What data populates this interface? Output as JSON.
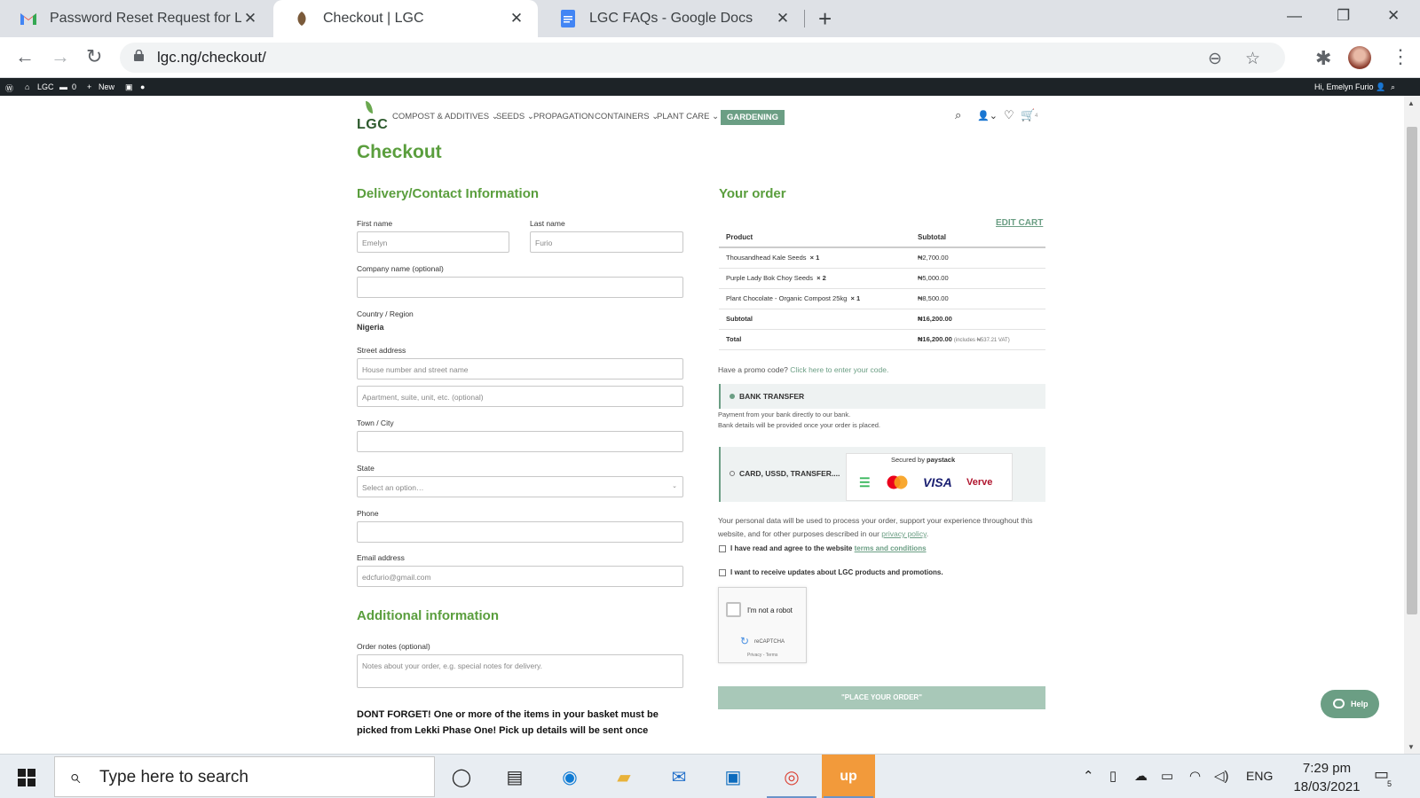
{
  "browser": {
    "tabs": [
      {
        "title": "Password Reset Request for LGC",
        "icon": "gmail-icon"
      },
      {
        "title": "Checkout | LGC",
        "icon": "leaf-icon"
      },
      {
        "title": "LGC FAQs - Google Docs",
        "icon": "google-docs-icon"
      }
    ],
    "url": "lgc.ng/checkout/"
  },
  "adminbar": {
    "site": "LGC",
    "comments": "0",
    "new": "New",
    "greeting": "Hi, Emelyn Furio"
  },
  "header": {
    "logo": "LGC",
    "menu": [
      "COMPOST & ADDITIVES",
      "SEEDS",
      "PROPAGATION",
      "CONTAINERS",
      "PLANT CARE"
    ],
    "gardening": "GARDENING",
    "cart_count": "4"
  },
  "checkout": {
    "title": "Checkout",
    "delivery_title": "Delivery/Contact Information",
    "first_name_label": "First name",
    "first_name_value": "Emelyn",
    "last_name_label": "Last name",
    "last_name_value": "Furio",
    "company_label": "Company name (optional)",
    "country_label": "Country / Region",
    "country_value": "Nigeria",
    "street_label": "Street address",
    "street_placeholder": "House number and street name",
    "street2_placeholder": "Apartment, suite, unit, etc. (optional)",
    "town_label": "Town / City",
    "state_label": "State",
    "state_placeholder": "Select an option…",
    "phone_label": "Phone",
    "email_label": "Email address",
    "email_value": "edcfurio@gmail.com",
    "additional_title": "Additional information",
    "notes_label": "Order notes (optional)",
    "notes_placeholder": "Notes about your order, e.g. special notes for delivery.",
    "dont_forget": "DONT FORGET! One or more of the items in your basket must be picked from Lekki Phase One! Pick up details will be sent once"
  },
  "order": {
    "title": "Your order",
    "edit_cart": "EDIT CART",
    "col_product": "Product",
    "col_subtotal": "Subtotal",
    "items": [
      {
        "name": "Thousandhead Kale Seeds",
        "qty": "× 1",
        "price": "₦2,700.00"
      },
      {
        "name": "Purple Lady Bok Choy Seeds",
        "qty": "× 2",
        "price": "₦5,000.00"
      },
      {
        "name": "Plant Chocolate - Organic Compost 25kg",
        "qty": "× 1",
        "price": "₦8,500.00"
      }
    ],
    "subtotal_label": "Subtotal",
    "subtotal_value": "₦16,200.00",
    "total_label": "Total",
    "total_value": "₦16,200.00",
    "total_vat": "(includes ₦537.21 VAT)",
    "promo_text": "Have a promo code?",
    "promo_link": "Click here to enter your code.",
    "bank_transfer": "BANK TRANSFER",
    "bank_desc_1": "Payment from your bank directly to our bank.",
    "bank_desc_2": "Bank details will be provided once your order is placed.",
    "card_option": "CARD, USSD, TRANSFER....",
    "secured_by": "Secured by",
    "paystack": "paystack",
    "visa": "VISA",
    "verve": "Verve",
    "privacy_text": "Your personal data will be used to process your order, support your experience throughout this website, and for other purposes described in our",
    "privacy_link": "privacy policy",
    "terms_text": "I have read and agree to the website",
    "terms_link": "terms and conditions",
    "updates_text": "I want to receive updates about LGC products and promotions.",
    "recaptcha_text": "I'm not a robot",
    "recaptcha_brand": "reCAPTCHA",
    "recaptcha_links": "Privacy - Terms",
    "place_order": "\"PLACE YOUR ORDER\"",
    "help": "Help"
  },
  "taskbar": {
    "search_placeholder": "Type here to search",
    "lang": "ENG",
    "time": "7:29 pm",
    "date": "18/03/2021",
    "notifications": "5"
  },
  "colors": {
    "brand_green": "#5a9e3d",
    "accent_teal": "#6b9e84"
  }
}
